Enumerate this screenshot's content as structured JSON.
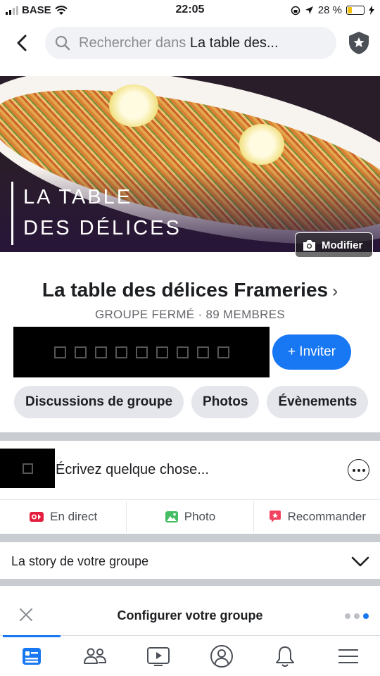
{
  "status_bar": {
    "carrier": "BASE",
    "time": "22:05",
    "battery": "28 %",
    "battery_level": 0.28
  },
  "search": {
    "prefix": "Rechercher dans",
    "group_name": "La table des..."
  },
  "cover": {
    "title_line1": "LA TABLE",
    "title_line2": "DES DÉLICES",
    "modify_label": "Modifier"
  },
  "group": {
    "name": "La table des délices Frameries",
    "chevron": "›",
    "meta": "GROUPE FERMÉ · 89 MEMBRES",
    "invite_label": "+ Inviter"
  },
  "chips": [
    "Discussions de groupe",
    "Photos",
    "Évènements"
  ],
  "composer": {
    "placeholder": "Écrivez quelque chose..."
  },
  "actions": {
    "live": "En direct",
    "photo": "Photo",
    "recommend": "Recommander"
  },
  "story": {
    "label": "La story de votre groupe"
  },
  "configure": {
    "title": "Configurer votre groupe"
  },
  "colors": {
    "accent": "#1877f2",
    "live": "#e41e3f",
    "photo": "#45bd62",
    "recommend": "#f3425f"
  },
  "tabs": [
    "news-feed-icon",
    "groups-icon",
    "watch-icon",
    "profile-icon",
    "notifications-icon",
    "menu-icon"
  ]
}
